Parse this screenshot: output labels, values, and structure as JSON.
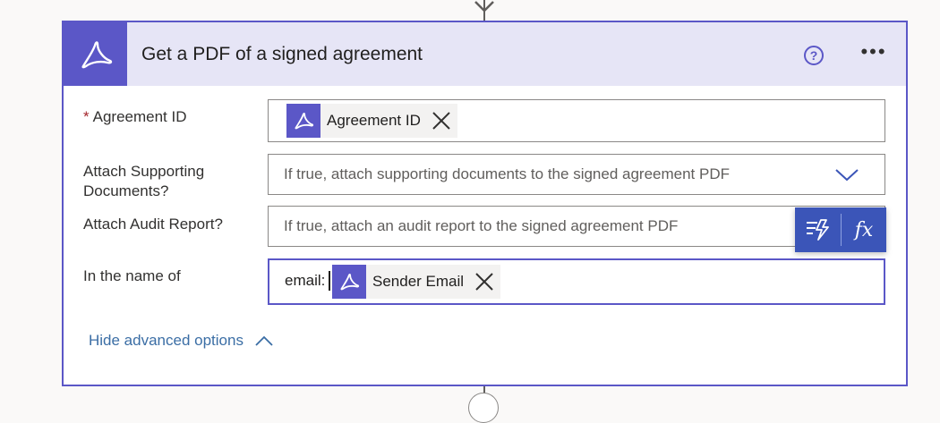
{
  "card": {
    "title": "Get a PDF of a signed agreement",
    "app_icon": "adobe-acrobat-sign-icon",
    "help_label": "?",
    "more_label": "•••",
    "accent_color": "#5b57c7",
    "header_bg": "#e6e5f6"
  },
  "fields": {
    "agreement_id": {
      "label": "Agreement ID",
      "required_marker": "*",
      "token_label": "Agreement ID",
      "token_icon": "adobe-acrobat-sign-icon"
    },
    "attach_supporting": {
      "label_line1": "Attach Supporting",
      "label_line2": "Documents?",
      "placeholder": "If true, attach supporting documents to the signed agreement PDF",
      "dropdown_icon": "chevron-down-icon"
    },
    "attach_audit": {
      "label": "Attach Audit Report?",
      "placeholder": "If true, attach an audit report to the signed agreement PDF"
    },
    "in_name_of": {
      "label": "In the name of",
      "typed_value": "email:",
      "token_label": "Sender Email",
      "token_icon": "adobe-acrobat-sign-icon"
    }
  },
  "flyout": {
    "dynamic_content_icon": "dynamic-content-icon",
    "expression_label": "fx",
    "bg_color": "#3b55b8"
  },
  "advanced": {
    "label": "Hide advanced options",
    "icon": "chevron-up-icon",
    "color": "#3b6ea5"
  }
}
